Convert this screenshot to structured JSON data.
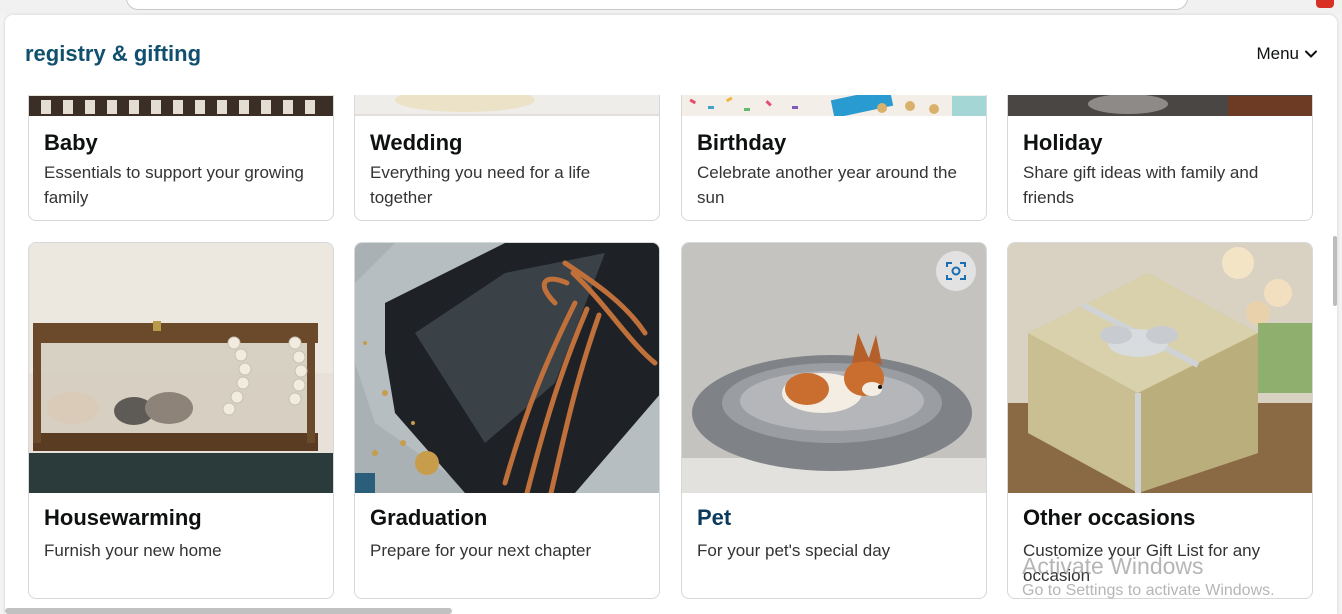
{
  "header": {
    "title": "registry & gifting",
    "menu_label": "Menu"
  },
  "cards": [
    {
      "title": "Baby",
      "desc": "Essentials to support your growing family"
    },
    {
      "title": "Wedding",
      "desc": "Everything you need for a life together"
    },
    {
      "title": "Birthday",
      "desc": "Celebrate another year around the sun"
    },
    {
      "title": "Holiday",
      "desc": "Share gift ideas with family and friends"
    },
    {
      "title": "Housewarming",
      "desc": "Furnish your new home"
    },
    {
      "title": "Graduation",
      "desc": "Prepare for your next chapter"
    },
    {
      "title": "Pet",
      "desc": "For your pet's special day"
    },
    {
      "title": "Other occasions",
      "desc": "Customize your Gift List for any occasion"
    }
  ],
  "watermark": {
    "line1": "Activate Windows",
    "line2": "Go to Settings to activate Windows."
  },
  "colors": {
    "title_brand": "#10506e",
    "card_border": "#d5d9d9",
    "pet_title": "#0c3a5c"
  },
  "icons": {
    "menu": "chevron-down-icon",
    "visual_search": "visual-search-icon"
  }
}
